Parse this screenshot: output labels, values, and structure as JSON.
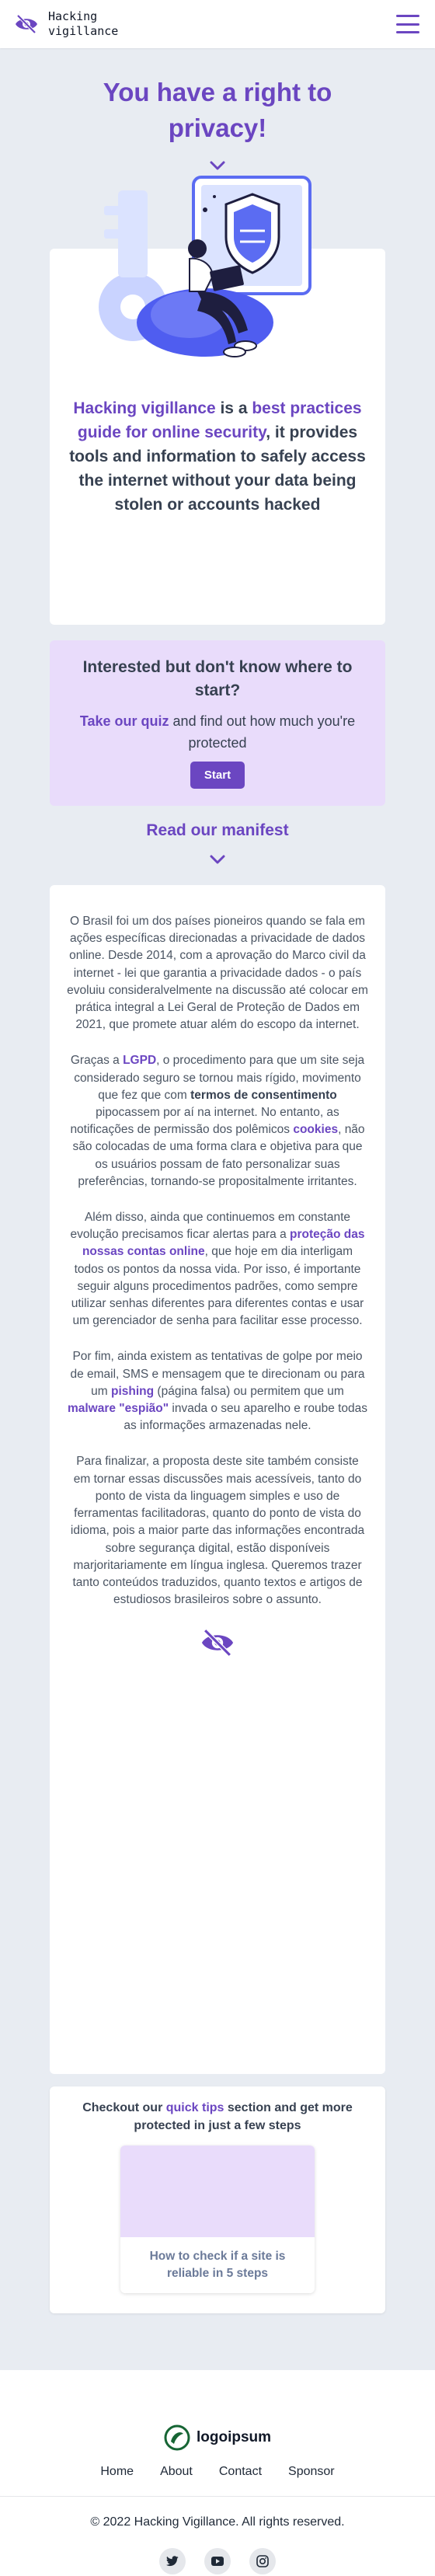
{
  "header": {
    "brand_name": "Hacking vigillance",
    "logo_icon": "eye-slash-icon",
    "menu_icon": "hamburger-menu-icon",
    "accent_color": "#6b46c1"
  },
  "hero": {
    "title": "You have a right to privacy!",
    "intro_accent_1": "Hacking vigillance",
    "intro_plain_1": " is a ",
    "intro_accent_2": "best practices guide for online security",
    "intro_plain_2": ", it provides tools and information to safely access the internet without your data being stolen or accounts hacked"
  },
  "quiz": {
    "title": "Interested but don't know where to start?",
    "link_text": "Take our quiz",
    "desc_rest": " and find out how much you're protected",
    "button_label": "Start",
    "background_color": "#e9dcfb"
  },
  "manifest": {
    "link_text": "Read our manifest",
    "p1": "O Brasil foi um dos países pioneiros quando se fala em ações específicas direcionadas a privacidade de dados online. Desde 2014, com a aprovação do Marco civil da internet - lei que garantia a privacidade dados - o país evoluiu consideralvelmente na discussão até colocar em prática integral a Lei Geral de Proteção de Dados em 2021, que promete atuar além do escopo da internet.",
    "p2_a": "Graças a ",
    "p2_b": "LGPD",
    "p2_c": ", o procedimento para que um site seja considerado seguro se tornou mais rígido, movimento que fez que com ",
    "p2_d": "termos de consentimento",
    "p2_e": " pipocassem por aí na internet. No entanto, as notificações de permissão dos polêmicos ",
    "p2_f": "cookies",
    "p2_g": ", não são colocadas de uma forma clara e objetiva para que os usuários possam de fato personalizar suas preferências, tornando-se propositalmente irritantes.",
    "p3_a": "Além disso, ainda que continuemos em constante evolução precisamos ficar alertas para a ",
    "p3_b": "proteção das nossas contas online",
    "p3_c": ", que hoje em dia interligam todos os pontos da nossa vida. Por isso, é importante seguir alguns procedimentos padrões, como sempre utilizar senhas diferentes para diferentes contas e usar um gerenciador de senha para facilitar esse processo.",
    "p4_a": "Por fim, ainda existem as tentativas de golpe por meio de email, SMS e mensagem que te direcionam ou para um ",
    "p4_b": "pishing",
    "p4_c": " (página falsa) ou permitem que um ",
    "p4_d": "malware \"espião\"",
    "p4_e": " invada o seu aparelho e roube todas as informações armazenadas nele.",
    "p5": "Para finalizar, a proposta deste site também consiste em tornar essas discussões mais acessíveis, tanto do ponto de vista da linguagem simples e uso de ferramentas facilitadoras, quanto do ponto de vista do idioma, pois a maior parte das informações encontrada sobre segurança digital, estão disponíveis marjoritariamente em língua inglesa. Queremos trazer tanto conteúdos traduzidos, quanto textos e artigos de estudiosos brasileiros sobre o assunto.",
    "end_icon": "eye-slash-icon"
  },
  "tips": {
    "title_a": "Checkout our ",
    "title_link": "quick tips",
    "title_b": " section and get more protected in just a few steps",
    "items": [
      {
        "caption": "How to check if a site is reliable in 5 steps"
      }
    ]
  },
  "footer": {
    "logo_text": "logoipsum",
    "nav": [
      "Home",
      "About",
      "Contact",
      "Sponsor"
    ],
    "copyright": "© 2022 Hacking Vigillance. All rights reserved.",
    "socials": [
      "twitter-icon",
      "youtube-icon",
      "instagram-icon"
    ]
  }
}
